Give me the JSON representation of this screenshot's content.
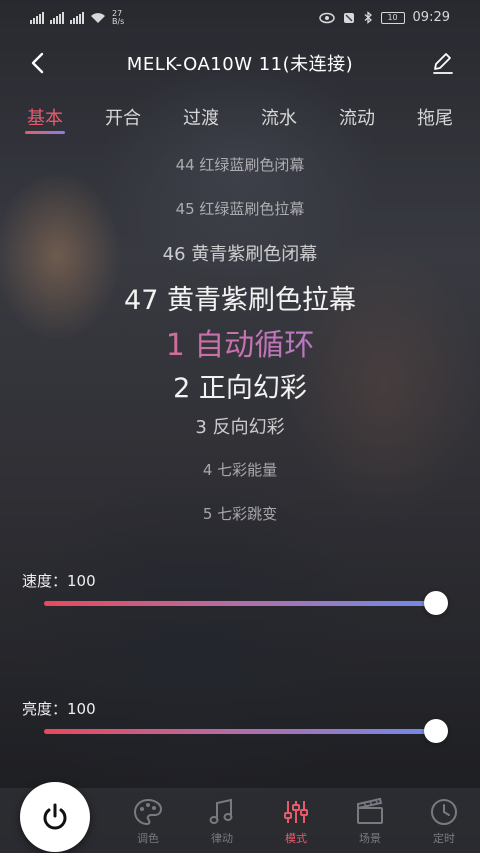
{
  "status_bar": {
    "network_speed": "27\nB/s",
    "time": "09:29",
    "battery": "10"
  },
  "header": {
    "title": "MELK-OA10W  11(未连接)"
  },
  "tabs": [
    {
      "label": "基本",
      "active": true
    },
    {
      "label": "开合",
      "active": false
    },
    {
      "label": "过渡",
      "active": false
    },
    {
      "label": "流水",
      "active": false
    },
    {
      "label": "流动",
      "active": false
    },
    {
      "label": "拖尾",
      "active": false
    }
  ],
  "picker": {
    "items": [
      "44 红绿蓝刷色闭幕",
      "45 红绿蓝刷色拉幕",
      "46 黄青紫刷色闭幕",
      "47 黄青紫刷色拉幕",
      "1 自动循环",
      "2 正向幻彩",
      "3 反向幻彩",
      "4 七彩能量",
      "5 七彩跳变"
    ],
    "selected": "1 自动循环"
  },
  "speed": {
    "label": "速度：",
    "value": "100",
    "level": 1.0
  },
  "brightness": {
    "label": "亮度：",
    "value": "100",
    "level": 1.0
  },
  "bottom_nav": [
    {
      "label": "调色",
      "icon": "palette-icon",
      "active": false
    },
    {
      "label": "律动",
      "icon": "music-note-icon",
      "active": false
    },
    {
      "label": "模式",
      "icon": "sliders-icon",
      "active": true
    },
    {
      "label": "场景",
      "icon": "clapperboard-icon",
      "active": false
    },
    {
      "label": "定时",
      "icon": "clock-icon",
      "active": false
    }
  ],
  "colors": {
    "accent_red": "#e85a6a",
    "accent_blue": "#6f8bec"
  }
}
